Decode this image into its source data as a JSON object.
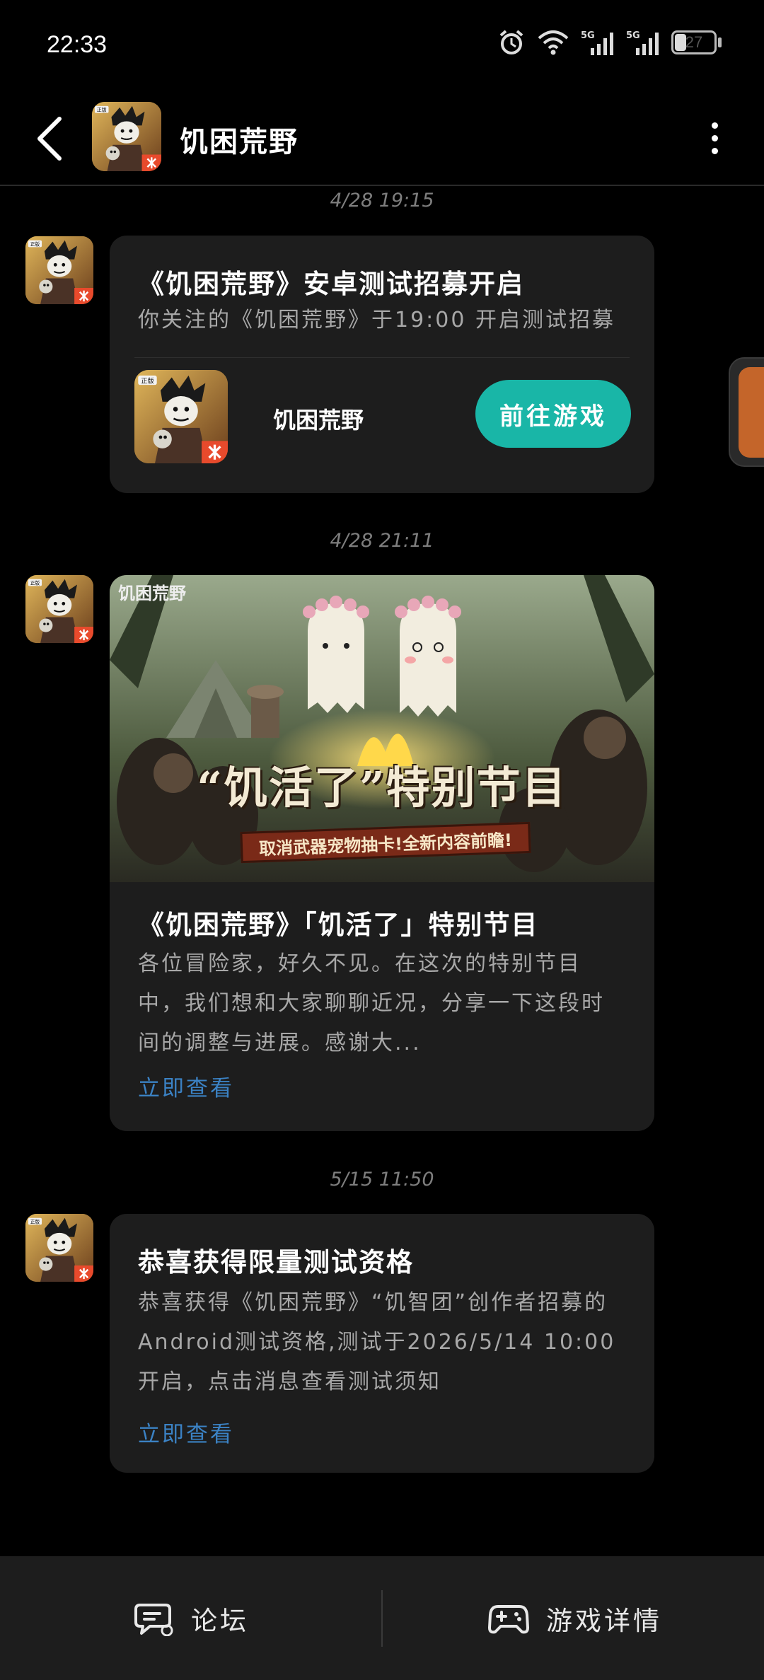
{
  "status_bar": {
    "time": "22:33",
    "battery": "27",
    "icons": [
      "alarm-icon",
      "wifi-icon",
      "signal-5g-icon",
      "signal-5g-icon",
      "battery-icon"
    ]
  },
  "header": {
    "title": "饥困荒野",
    "back_icon": "chevron-left-icon",
    "more_icon": "more-vertical-icon"
  },
  "messages": [
    {
      "timestamp": "4/28 19:15",
      "title": "《饥困荒野》安卓测试招募开启",
      "body": "你关注的《饥困荒野》于19:00 开启测试招募",
      "game_name": "饥困荒野",
      "button_label": "前往游戏"
    },
    {
      "timestamp": "4/28 21:11",
      "banner_logo": "饥困荒野",
      "banner_title": "“饥活了”特别节目",
      "banner_subtitle": "取消武器宠物抽卡!全新内容前瞻!",
      "title": "《饥困荒野》「饥活了」特别节目",
      "body": "各位冒险家，好久不见。在这次的特别节目中，我们想和大家聊聊近况，分享一下这段时间的调整与进展。感谢大...",
      "link_label": "立即查看"
    },
    {
      "timestamp": "5/15 11:50",
      "title": "恭喜获得限量测试资格",
      "body": "恭喜获得《饥困荒野》“饥智团”创作者招募的Android测试资格,测试于2026/5/14 10:00 开启，点击消息查看测试须知",
      "link_label": "立即查看"
    }
  ],
  "bottom_bar": {
    "forum_label": "论坛",
    "forum_icon": "chat-bubble-icon",
    "details_label": "游戏详情",
    "details_icon": "gamepad-icon"
  }
}
